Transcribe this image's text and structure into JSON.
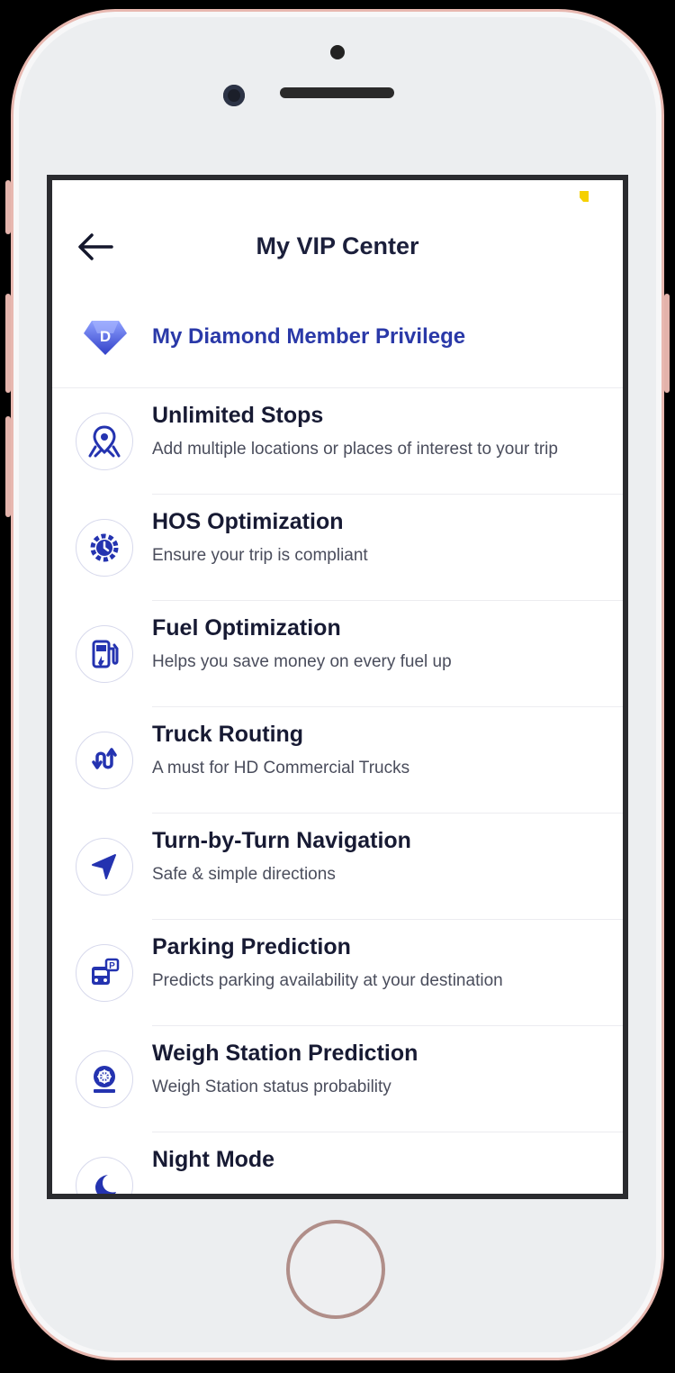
{
  "header": {
    "title": "My VIP Center",
    "back_icon": "arrow-left-icon"
  },
  "vip": {
    "label": "My Diamond Member Privilege",
    "badge_letter": "D",
    "badge_icon": "diamond-badge-icon"
  },
  "features": [
    {
      "title": "Unlimited Stops",
      "subtitle": "Add multiple locations or places of interest to your trip",
      "icon": "map-pin-icon"
    },
    {
      "title": "HOS Optimization",
      "subtitle": "Ensure your trip is compliant",
      "icon": "gear-clock-icon"
    },
    {
      "title": "Fuel Optimization",
      "subtitle": "Helps you save money on every fuel up",
      "icon": "fuel-pump-icon"
    },
    {
      "title": "Truck Routing",
      "subtitle": "A must for HD Commercial Trucks",
      "icon": "route-icon"
    },
    {
      "title": "Turn-by-Turn Navigation",
      "subtitle": "Safe & simple directions",
      "icon": "navigation-arrow-icon"
    },
    {
      "title": "Parking Prediction",
      "subtitle": "Predicts parking availability at your destination",
      "icon": "parking-bus-icon"
    },
    {
      "title": "Weigh Station Prediction",
      "subtitle": "Weigh Station status probability",
      "icon": "weigh-station-icon"
    },
    {
      "title": "Night Mode",
      "subtitle": "",
      "icon": "moon-icon"
    }
  ],
  "colors": {
    "accent": "#2a39a8",
    "icon_blue": "#2433b0",
    "title_text": "#171a33",
    "subtitle_text": "#4a4d5c",
    "status_mark": "#f5d000"
  }
}
